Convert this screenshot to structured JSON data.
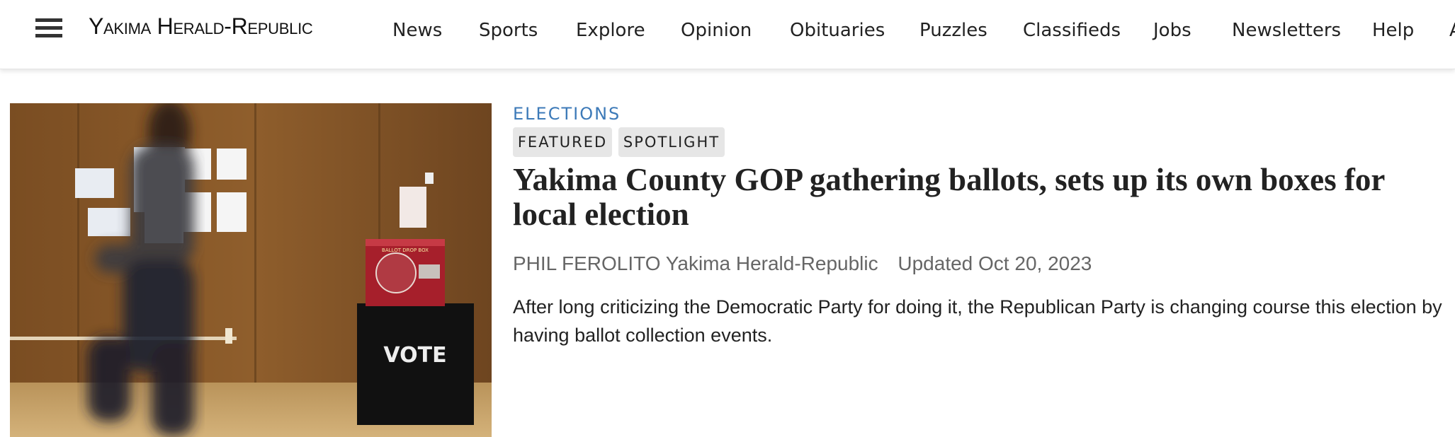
{
  "header": {
    "menu_icon": "hamburger-menu-icon",
    "logo_text": "Yakima Herald-Republic",
    "nav": [
      {
        "label": "News"
      },
      {
        "label": "Sports"
      },
      {
        "label": "Explore"
      },
      {
        "label": "Opinion"
      },
      {
        "label": "Obituaries"
      },
      {
        "label": "Puzzles"
      },
      {
        "label": "Classifieds"
      },
      {
        "label": "Jobs"
      },
      {
        "label": "Newsletters"
      },
      {
        "label": "Help"
      }
    ],
    "nav_overflow_partial": "A"
  },
  "article": {
    "section": "ELECTIONS",
    "tags": [
      "FEATURED",
      "SPOTLIGHT"
    ],
    "headline": "Yakima County GOP gathering ballots, sets up its own boxes for local election",
    "author": "PHIL FEROLITO",
    "publication": "Yakima Herald-Republic",
    "updated": "Updated Oct 20, 2023",
    "summary": "After long criticizing the Democratic Party for doing it, the Republican Party is changing course this election by having ballot collection events.",
    "photo": {
      "ballot_box_sign": "VOTE",
      "ballot_box_label": "BALLOT DROP BOX"
    }
  },
  "colors": {
    "section_accent": "#3d7ab8",
    "tag_background": "#e6e6e6",
    "byline_text": "#666666"
  }
}
